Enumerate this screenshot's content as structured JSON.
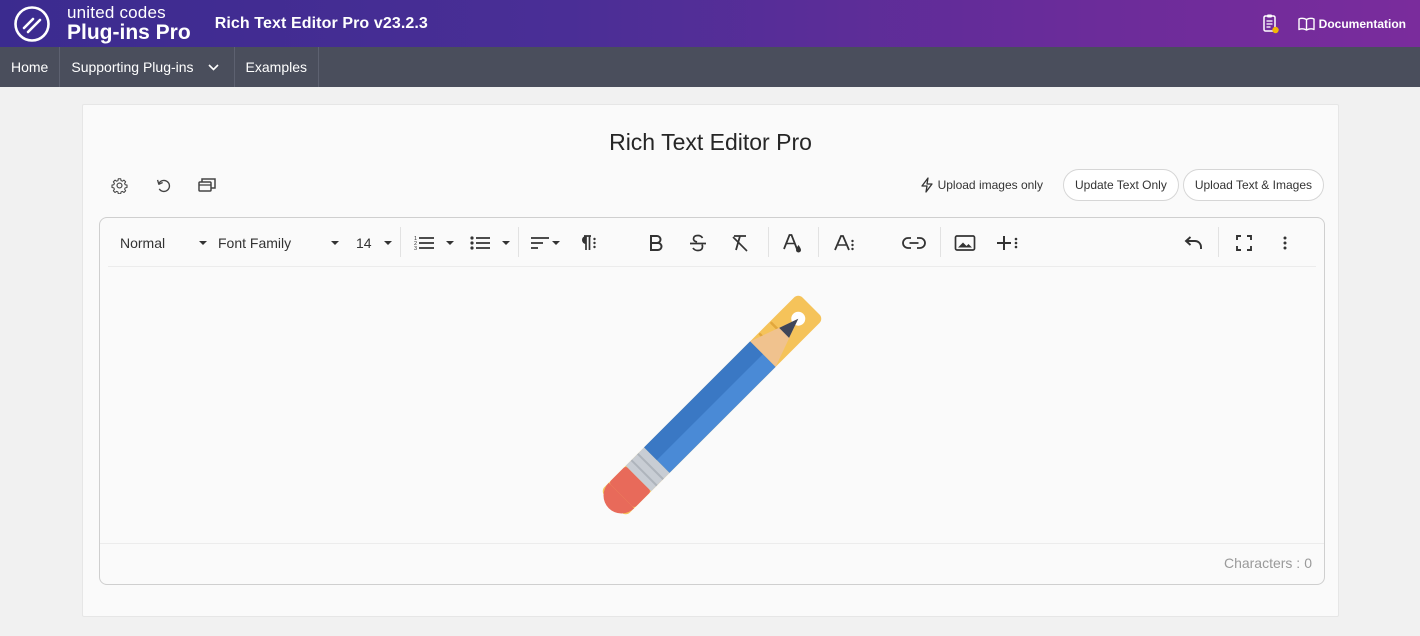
{
  "header": {
    "logo_top": "united codes",
    "logo_bottom": "Plug-ins Pro",
    "app_title": "Rich Text Editor Pro v23.2.3",
    "documentation_label": "Documentation",
    "colors": {
      "gradient_start": "#3b2b8f",
      "gradient_end": "#7a2c9c"
    }
  },
  "nav": {
    "items": [
      {
        "label": "Home"
      },
      {
        "label": "Supporting Plug-ins"
      },
      {
        "label": "Examples"
      }
    ]
  },
  "card": {
    "title": "Rich Text Editor Pro",
    "actions": {
      "upload_images_only": "Upload images only",
      "update_text_only": "Update Text Only",
      "upload_text_images": "Upload Text & Images"
    }
  },
  "editor": {
    "toolbar": {
      "paragraph_style": "Normal",
      "font_family": "Font Family",
      "font_size": "14",
      "icons": [
        "ordered-list-icon",
        "unordered-list-icon",
        "align-icon",
        "paragraph-format-icon",
        "bold-icon",
        "strikethrough-icon",
        "clear-formatting-icon",
        "text-color-icon",
        "font-size-icon",
        "link-icon",
        "image-icon",
        "insert-more-icon",
        "undo-icon",
        "fullscreen-icon",
        "more-icon"
      ]
    },
    "content_illustration": "ruler-and-pencil",
    "counter_label": "Characters :",
    "counter_value": "0"
  }
}
